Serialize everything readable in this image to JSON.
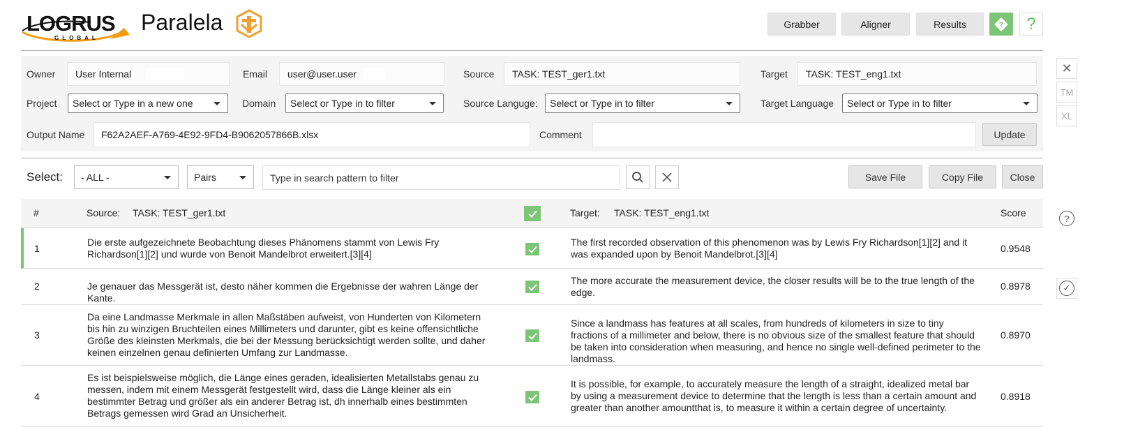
{
  "header": {
    "logo_text": "LOGRUS",
    "logo_sub": "GLOBAL",
    "app_title": "Paralela",
    "nav": [
      {
        "label": "Grabber"
      },
      {
        "label": "Aligner"
      },
      {
        "label": "Results"
      }
    ],
    "accent": "#7cc576"
  },
  "info": {
    "owner_label": "Owner",
    "owner_value": "User Internal",
    "email_label": "Email",
    "email_value": "user@user.user",
    "source_label": "Source",
    "source_value": "TASK: TEST_ger1.txt",
    "target_label": "Target",
    "target_value": "TASK: TEST_eng1.txt",
    "project_label": "Project",
    "project_placeholder": "Select or Type in a new one",
    "domain_label": "Domain",
    "domain_placeholder": "Select or Type in to filter",
    "source_lang_label": "Source Languge:",
    "source_lang_placeholder": "Select or Type in to filter",
    "target_lang_label": "Target Language",
    "target_lang_placeholder": "Select or Type in to filter",
    "output_label": "Output Name",
    "output_value": "F62A2AEF-A769-4E92-9FD4-B9062057866B.xlsx",
    "comment_label": "Comment",
    "comment_value": "",
    "update_label": "Update"
  },
  "side": {
    "tm_label": "TM",
    "xl_label": "XL"
  },
  "filter": {
    "select_label": "Select:",
    "scope_value": "- ALL -",
    "mode_value": "Pairs",
    "search_placeholder": "Type in search pattern to filter",
    "save_label": "Save File",
    "copy_label": "Copy File",
    "close_label": "Close"
  },
  "table": {
    "col_num": "#",
    "col_source_label": "Source:",
    "col_source_file": "TASK: TEST_ger1.txt",
    "col_target_label": "Target:",
    "col_target_file": "TASK: TEST_eng1.txt",
    "col_score": "Score",
    "rows": [
      {
        "num": "1",
        "source": "Die erste aufgezeichnete Beobachtung dieses Phänomens stammt von Lewis Fry Richardson[1][2] und wurde von Benoit Mandelbrot erweitert.[3][4]",
        "target": "The first recorded observation of this phenomenon was by Lewis Fry Richardson[1][2] and it was expanded upon by Benoit Mandelbrot.[3][4]",
        "score": "0.9548"
      },
      {
        "num": "2",
        "source": "Je genauer das Messgerät ist, desto näher kommen die Ergebnisse der wahren Länge der Kante.",
        "target": "The more accurate the measurement device, the closer results will be to the true length of the edge.",
        "score": "0.8978"
      },
      {
        "num": "3",
        "source": "Da eine Landmasse Merkmale in allen Maßstäben aufweist, von Hunderten von Kilometern bis hin zu winzigen Bruchteilen eines Millimeters und darunter, gibt es keine offensichtliche Größe des kleinsten Merkmals, die bei der Messung berücksichtigt werden sollte, und daher keinen einzelnen genau definierten Umfang zur Landmasse.",
        "target": "Since a landmass has features at all scales, from hundreds of kilometers in size to tiny fractions of a millimeter and below, there is no obvious size of the smallest feature that should be taken into consideration when measuring, and hence no single well-defined perimeter to the landmass.",
        "score": "0.8970"
      },
      {
        "num": "4",
        "source": "Es ist beispielsweise möglich, die Länge eines geraden, idealisierten Metallstabs genau zu messen, indem mit einem Messgerät festgestellt wird, dass die Länge kleiner als ein bestimmter Betrag und größer als ein anderer Betrag ist, dh innerhalb eines bestimmten Betrags gemessen wird Grad an Unsicherheit.",
        "target": "It is possible, for example, to accurately measure the length of a straight, idealized metal bar by using a measurement device to determine that the length is less than a certain amount and greater than another amountthat is, to measure it within a certain degree of uncertainty.",
        "score": "0.8918"
      }
    ]
  }
}
